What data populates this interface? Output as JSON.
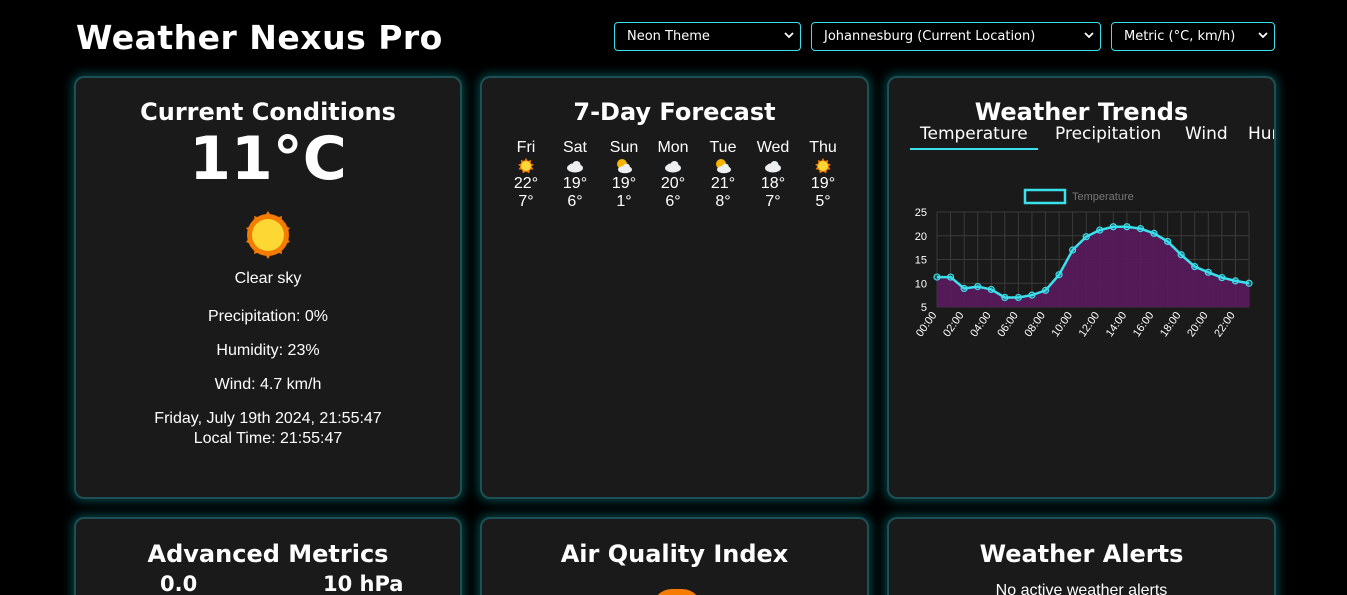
{
  "header": {
    "title": "Weather Nexus Pro"
  },
  "controls": {
    "theme": "Neon Theme",
    "location": "Johannesburg (Current Location)",
    "units": "Metric (°C, km/h)"
  },
  "current": {
    "title": "Current Conditions",
    "temperature": "11°C",
    "icon": "sun-icon",
    "condition": "Clear sky",
    "precipitation": "Precipitation: 0%",
    "humidity": "Humidity: 23%",
    "wind": "Wind: 4.7 km/h",
    "datetime": "Friday, July 19th 2024, 21:55:47",
    "local_time": "Local Time: 21:55:47"
  },
  "forecast": {
    "title": "7-Day Forecast",
    "days": [
      {
        "day": "Fri",
        "icon": "sun-icon",
        "high": "22°",
        "low": "7°"
      },
      {
        "day": "Sat",
        "icon": "cloud-icon",
        "high": "19°",
        "low": "6°"
      },
      {
        "day": "Sun",
        "icon": "partly-cloudy-icon",
        "high": "19°",
        "low": "1°"
      },
      {
        "day": "Mon",
        "icon": "cloud-icon",
        "high": "20°",
        "low": "6°"
      },
      {
        "day": "Tue",
        "icon": "partly-cloudy-icon",
        "high": "21°",
        "low": "8°"
      },
      {
        "day": "Wed",
        "icon": "cloud-icon",
        "high": "18°",
        "low": "7°"
      },
      {
        "day": "Thu",
        "icon": "sun-icon",
        "high": "19°",
        "low": "5°"
      }
    ]
  },
  "trends": {
    "title": "Weather Trends",
    "tabs": [
      "Temperature",
      "Precipitation",
      "Wind",
      "Humidity"
    ],
    "active_tab": "Temperature"
  },
  "chart_data": {
    "type": "area",
    "legend": "Temperature",
    "x": [
      "00:00",
      "01:00",
      "02:00",
      "03:00",
      "04:00",
      "05:00",
      "06:00",
      "07:00",
      "08:00",
      "09:00",
      "10:00",
      "11:00",
      "12:00",
      "13:00",
      "14:00",
      "15:00",
      "16:00",
      "17:00",
      "18:00",
      "19:00",
      "20:00",
      "21:00",
      "22:00",
      "23:00"
    ],
    "xticks": [
      "00:00",
      "02:00",
      "04:00",
      "06:00",
      "08:00",
      "10:00",
      "12:00",
      "14:00",
      "16:00",
      "18:00",
      "20:00",
      "22:00"
    ],
    "series": [
      {
        "name": "Temperature",
        "values": [
          11.3,
          11.3,
          8.9,
          9.3,
          8.7,
          7.0,
          7.0,
          7.5,
          8.5,
          11.8,
          17.0,
          19.8,
          21.2,
          21.9,
          21.9,
          21.5,
          20.5,
          18.8,
          16.0,
          13.5,
          12.3,
          11.2,
          10.5,
          10.0
        ]
      }
    ],
    "ylim": [
      5,
      25
    ],
    "yticks": [
      5,
      10,
      15,
      20,
      25
    ],
    "grid": true,
    "colors": {
      "line": "#3ae0ec",
      "fill": "#5b1a5e"
    }
  },
  "metrics": {
    "title": "Advanced Metrics",
    "value_a": "0.0",
    "value_b": "10 hPa"
  },
  "aqi": {
    "title": "Air Quality Index"
  },
  "alerts": {
    "title": "Weather Alerts",
    "message": "No active weather alerts"
  },
  "colors": {
    "accent": "#3ae0ec",
    "card": "#1a1a1a",
    "sun": "#fdd835"
  }
}
